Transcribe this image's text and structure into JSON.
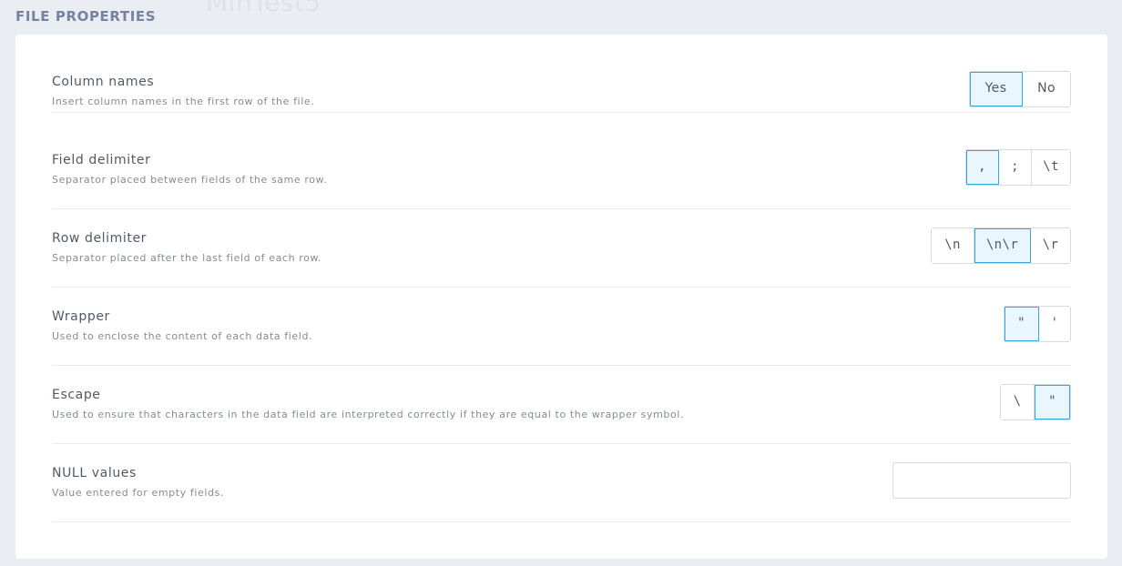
{
  "ghost_title": "MinTest5",
  "section_title": "FILE PROPERTIES",
  "rows": {
    "column_names": {
      "label": "Column names",
      "description": "Insert column names in the first row of the file.",
      "options": [
        "Yes",
        "No"
      ],
      "selected": "Yes"
    },
    "field_delimiter": {
      "label": "Field delimiter",
      "description": "Separator placed between fields of the same row.",
      "options": [
        ",",
        ";",
        "\\t"
      ],
      "selected": ","
    },
    "row_delimiter": {
      "label": "Row delimiter",
      "description": "Separator placed after the last field of each row.",
      "options": [
        "\\n",
        "\\n\\r",
        "\\r"
      ],
      "selected": "\\n\\r"
    },
    "wrapper": {
      "label": "Wrapper",
      "description": "Used to enclose the content of each data field.",
      "options": [
        "\"",
        "'"
      ],
      "selected": "\""
    },
    "escape": {
      "label": "Escape",
      "description": "Used to ensure that characters in the data field are interpreted correctly if they are equal to the wrapper symbol.",
      "options": [
        "\\",
        "\""
      ],
      "selected": "\""
    },
    "null_values": {
      "label": "NULL values",
      "description": "Value entered for empty fields.",
      "value": "",
      "placeholder": ""
    }
  },
  "colors": {
    "page_background": "#eaedf1",
    "card_background": "#ffffff",
    "section_title": "#7583a0",
    "active_border": "#3aa6df",
    "active_fill": "#e9f6fd"
  }
}
